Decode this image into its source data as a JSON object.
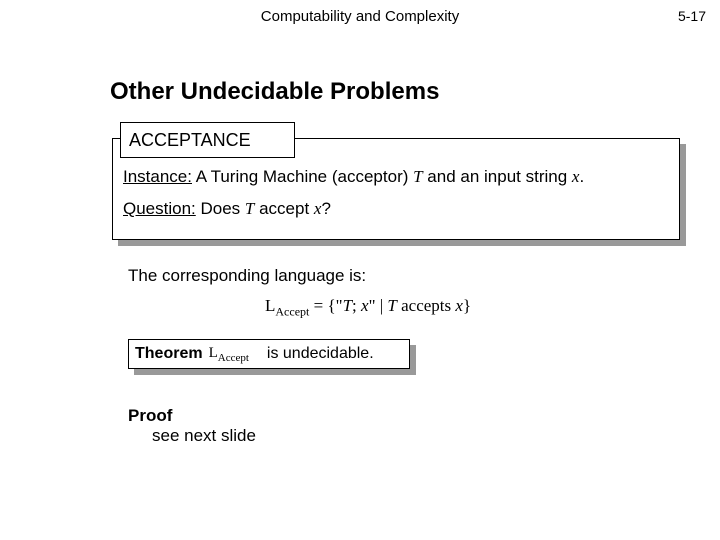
{
  "header": {
    "title": "Computability and Complexity",
    "page_number": "5-17"
  },
  "title": "Other Undecidable Problems",
  "problem_label": "ACCEPTANCE",
  "definition": {
    "instance_label": "Instance:",
    "instance_text_a": "  A Turing Machine  (acceptor)  ",
    "instance_var1": "T",
    "instance_text_b": "  and an input string  ",
    "instance_var2": "x",
    "instance_period": ".",
    "question_label": "Question:",
    "question_text_a": "  Does  ",
    "question_var1": "T",
    "question_text_b": "  accept  ",
    "question_var2": "x",
    "question_qmark": "?"
  },
  "language_line": "The corresponding language is:",
  "formula": {
    "lhs_sym": "L",
    "lhs_sub": "Accept",
    "eq": " = {\"",
    "t": "T",
    "sep": "; ",
    "x": "x",
    "mid": "\" | ",
    "t2": "T",
    "tail": "  accepts ",
    "x2": "x",
    "close": "}"
  },
  "theorem": {
    "label": "Theorem",
    "sym": "L",
    "sub": "Accept",
    "text": "is undecidable."
  },
  "proof": {
    "label": "Proof",
    "text": "see next slide"
  }
}
